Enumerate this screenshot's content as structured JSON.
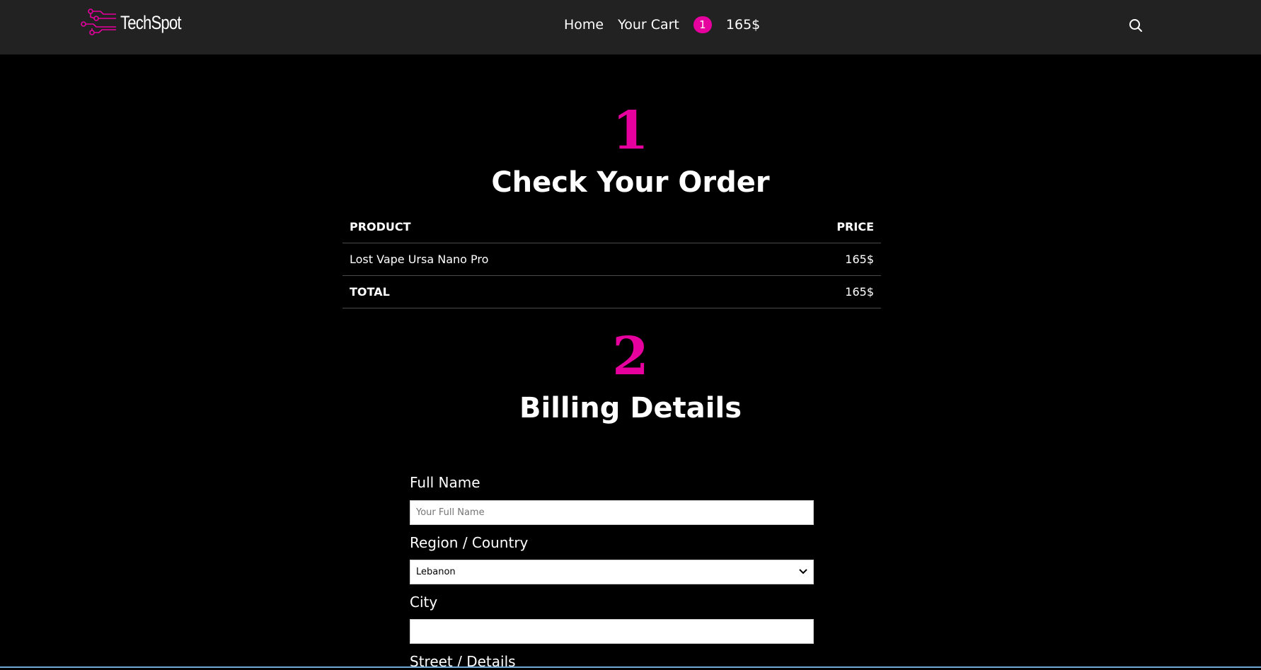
{
  "header": {
    "logo_text": "TechSpot",
    "nav": {
      "home": "Home",
      "cart": "Your Cart",
      "cart_count": "1",
      "cart_total": "165$"
    },
    "icons": {
      "logo": "circuit-icon",
      "search": "search-icon"
    },
    "accent_color": "#e6009e"
  },
  "order_section": {
    "step": "1",
    "title": "Check Your Order",
    "table": {
      "headers": {
        "product": "PRODUCT",
        "price": "PRICE"
      },
      "rows": [
        {
          "product": "Lost Vape Ursa Nano Pro",
          "price": "165$"
        }
      ],
      "total_label": "TOTAL",
      "total_value": "165$"
    }
  },
  "billing_section": {
    "step": "2",
    "title": "Billing Details",
    "fields": {
      "full_name": {
        "label": "Full Name",
        "placeholder": "Your Full Name",
        "value": ""
      },
      "country": {
        "label": "Region / Country",
        "value": "Lebanon"
      },
      "city": {
        "label": "City",
        "value": ""
      },
      "street": {
        "label": "Street / Details"
      }
    }
  }
}
